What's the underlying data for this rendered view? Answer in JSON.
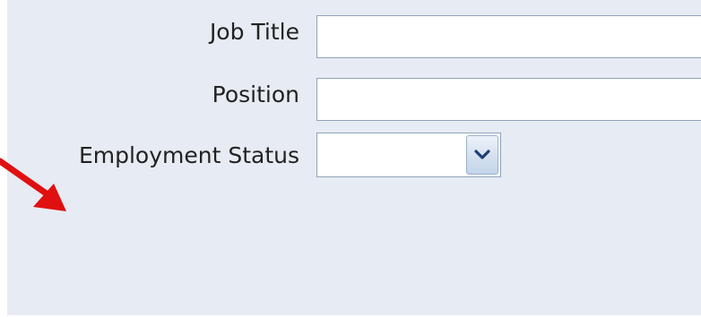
{
  "form": {
    "fields": [
      {
        "label": "Job Title",
        "value": ""
      },
      {
        "label": "Position",
        "value": ""
      }
    ],
    "employment_status": {
      "label": "Employment Status",
      "selected": ""
    }
  },
  "colors": {
    "panel_background": "#e7ebf3",
    "input_border": "#8fa4bd",
    "annotation_arrow": "#e01010"
  },
  "icons": {
    "dropdown": "chevron-down-icon",
    "annotation": "red-arrow-icon"
  }
}
